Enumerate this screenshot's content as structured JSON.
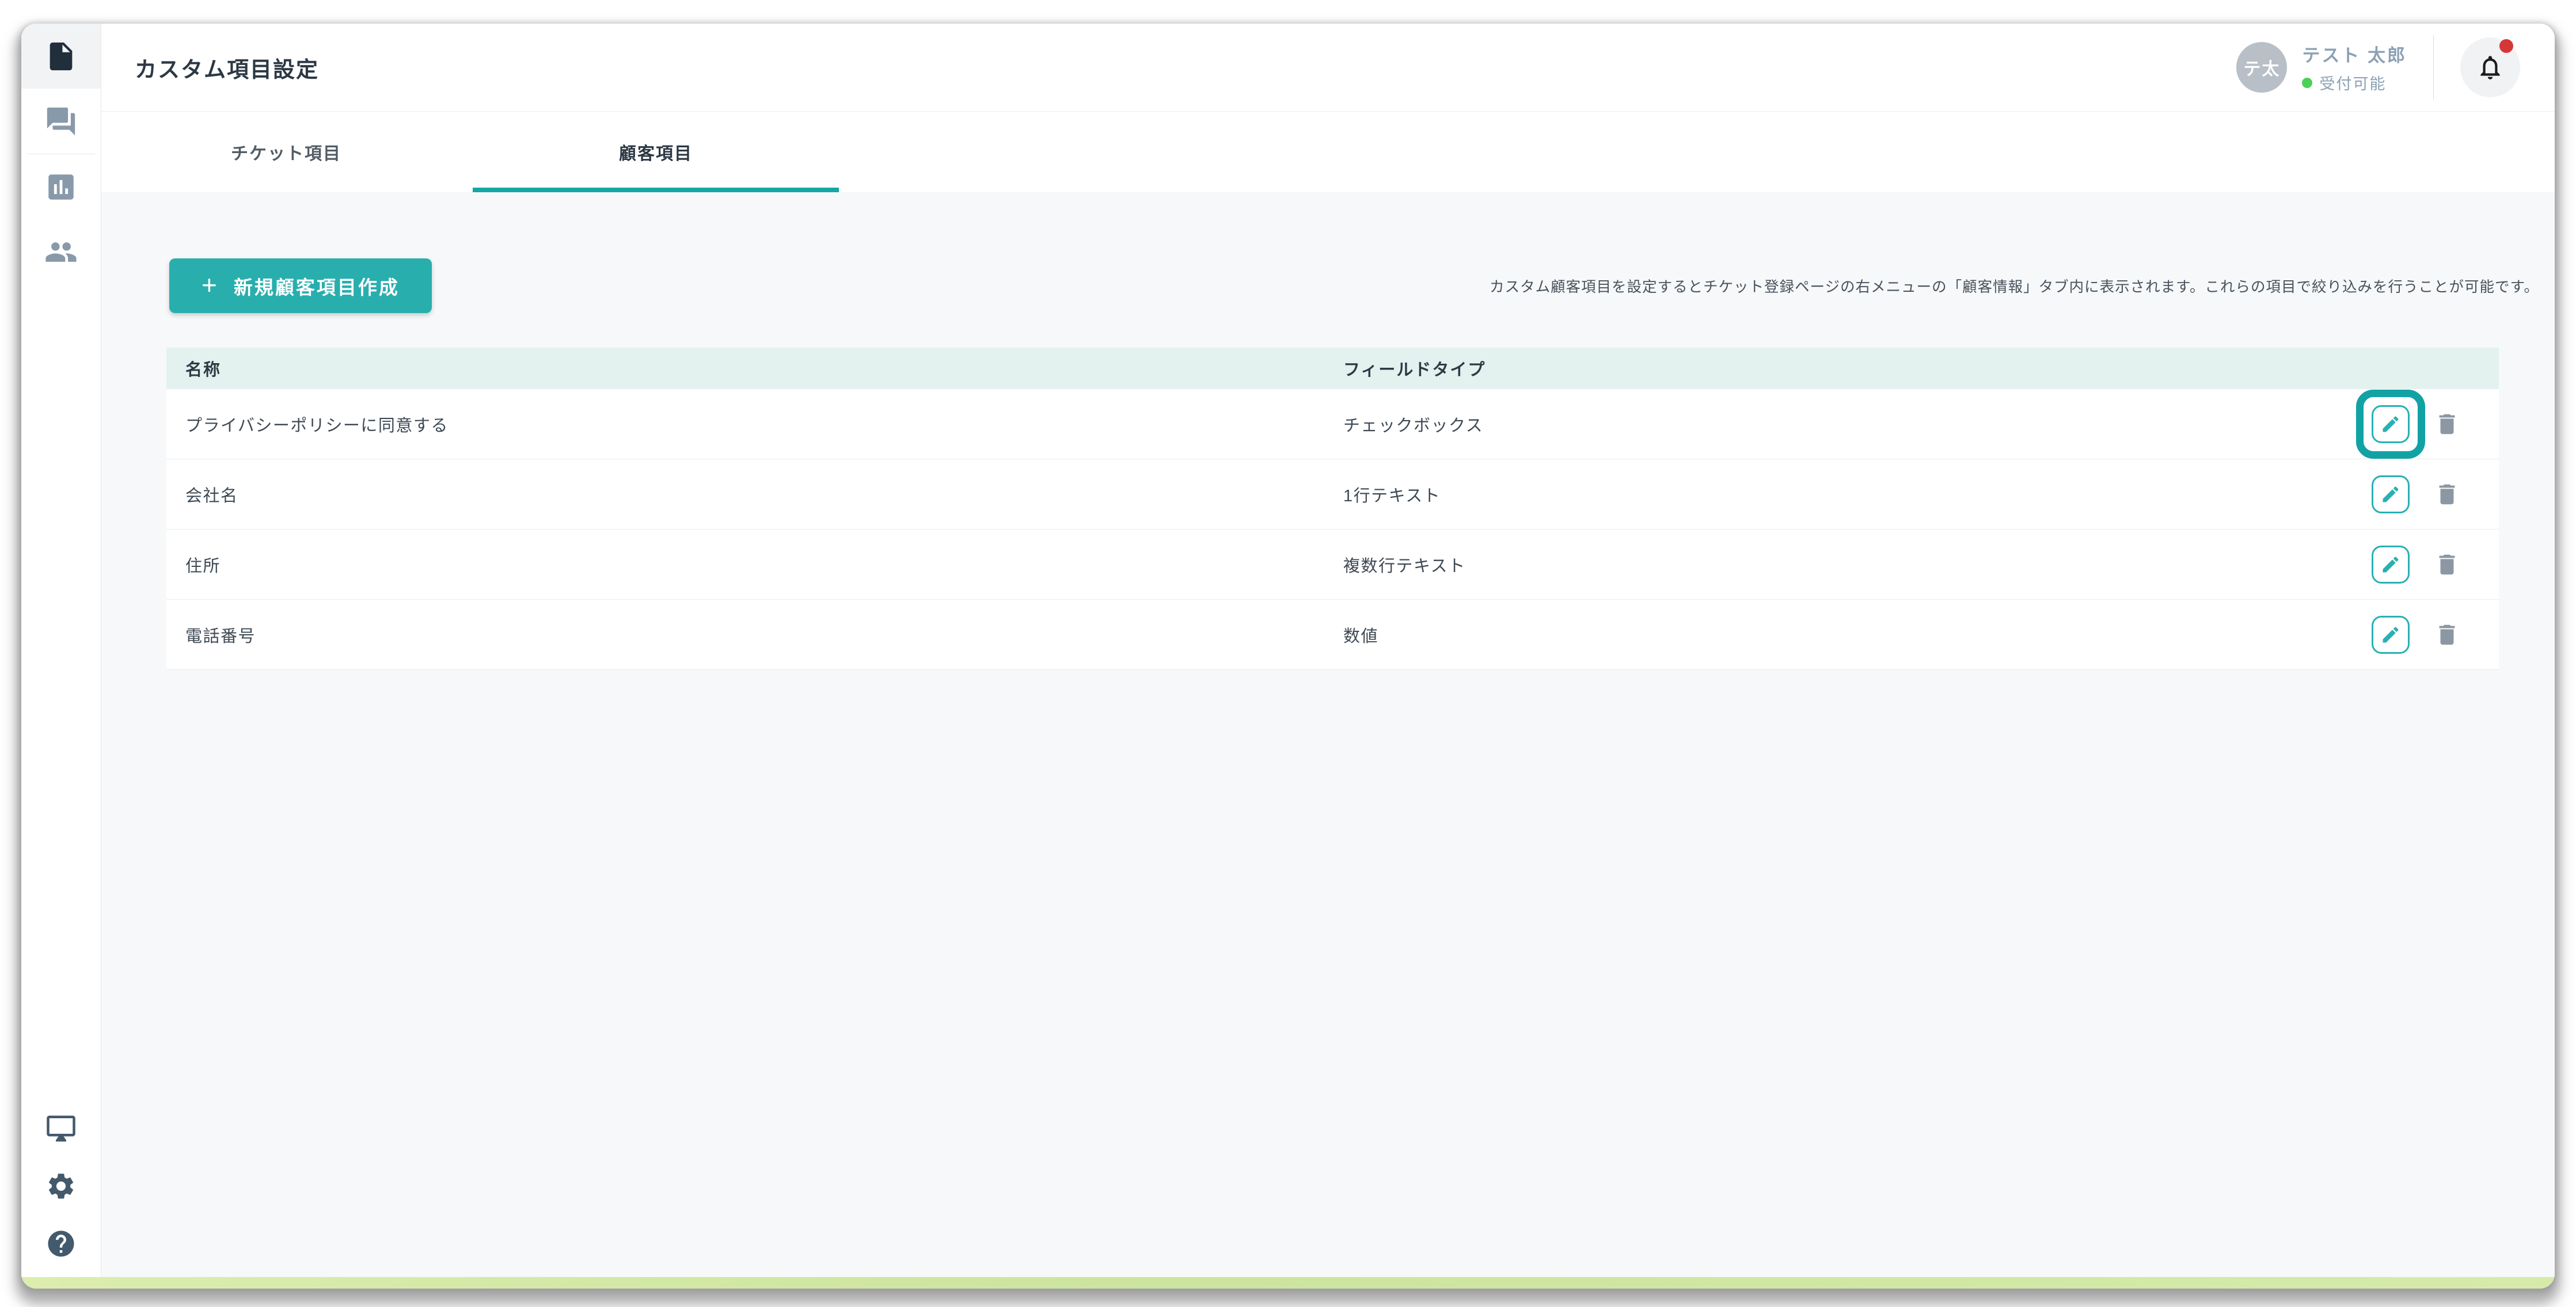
{
  "header": {
    "title": "カスタム項目設定",
    "user": {
      "avatar_initials": "テ太",
      "name": "テスト 太郎",
      "status": "受付可能"
    },
    "notification": {
      "icon": "bell-icon",
      "unread": true
    }
  },
  "sidebar": {
    "items": [
      {
        "icon": "document-icon",
        "active": true
      },
      {
        "icon": "chat-icon",
        "active": false
      },
      {
        "icon": "bar-chart-icon",
        "active": false
      },
      {
        "icon": "people-icon",
        "active": false
      }
    ],
    "footer_items": [
      {
        "icon": "monitor-icon"
      },
      {
        "icon": "settings-gear-icon"
      },
      {
        "icon": "help-icon"
      }
    ]
  },
  "tabs": [
    {
      "label": "チケット項目",
      "active": false
    },
    {
      "label": "顧客項目",
      "active": true
    }
  ],
  "toolbar": {
    "create_button": {
      "plus": "+",
      "label": "新規顧客項目作成"
    },
    "description": "カスタム顧客項目を設定するとチケット登録ページの右メニューの「顧客情報」タブ内に表示されます。これらの項目で絞り込みを行うことが可能です。"
  },
  "table": {
    "columns": [
      "名称",
      "フィールドタイプ"
    ],
    "rows": [
      {
        "name": "プライバシーポリシーに同意する",
        "type": "チェックボックス",
        "highlighted": true
      },
      {
        "name": "会社名",
        "type": "1行テキスト",
        "highlighted": false
      },
      {
        "name": "住所",
        "type": "複数行テキスト",
        "highlighted": false
      },
      {
        "name": "電話番号",
        "type": "数値",
        "highlighted": false
      }
    ]
  },
  "colors": {
    "accent_teal": "#29aeae",
    "tab_underline": "#16a6a6",
    "table_header_bg": "#e3f1ef",
    "highlight_ring": "#11a2a4",
    "status_green": "#4bd058",
    "notification_red": "#d53737",
    "bottom_bar_green": "#cfe5a2"
  }
}
